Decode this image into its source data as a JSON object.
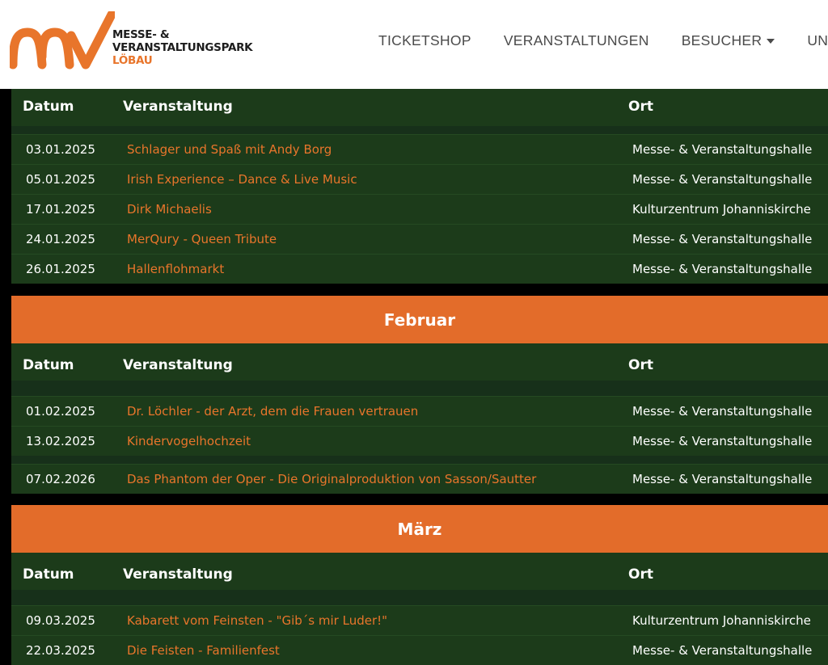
{
  "brand": {
    "line1": "MESSE- &",
    "line2": "VERANSTALTUNGSPARK",
    "line3": "LÖBAU",
    "colors": {
      "orange": "#e8752b",
      "dark_green": "#1c3b1a",
      "month_bar": "#e36c2a"
    }
  },
  "nav": {
    "items": [
      "TICKETSHOP",
      "VERANSTALTUNGEN",
      "BESUCHER",
      "UNTER"
    ]
  },
  "table_headers": {
    "date": "Datum",
    "event": "Veranstaltung",
    "location": "Ort"
  },
  "january": {
    "rows": [
      {
        "date": "03.01.2025",
        "event": "Schlager und Spaß mit Andy Borg",
        "location": "Messe- & Veranstaltungshalle"
      },
      {
        "date": "05.01.2025",
        "event": "Irish Experience – Dance & Live Music",
        "location": "Messe- & Veranstaltungshalle"
      },
      {
        "date": "17.01.2025",
        "event": "Dirk Michaelis",
        "location": "Kulturzentrum Johanniskirche"
      },
      {
        "date": "24.01.2025",
        "event": "MerQury - Queen Tribute",
        "location": "Messe- & Veranstaltungshalle"
      },
      {
        "date": "26.01.2025",
        "event": "Hallenflohmarkt",
        "location": "Messe- & Veranstaltungshalle"
      }
    ]
  },
  "february": {
    "title": "Februar",
    "rows": [
      {
        "date": "01.02.2025",
        "event": "Dr. Löchler - der Arzt, dem die Frauen vertrauen",
        "location": "Messe- & Veranstaltungshalle"
      },
      {
        "date": "13.02.2025",
        "event": "Kindervogelhochzeit",
        "location": "Messe- & Veranstaltungshalle"
      },
      {
        "date": "07.02.2026",
        "event": "Das Phantom der Oper - Die Originalproduktion von Sasson/Sautter",
        "location": "Messe- & Veranstaltungshalle"
      }
    ]
  },
  "march": {
    "title": "März",
    "rows": [
      {
        "date": "09.03.2025",
        "event": "Kabarett vom Feinsten - \"Gib´s mir Luder!\"",
        "location": "Kulturzentrum Johanniskirche"
      },
      {
        "date": "22.03.2025",
        "event": "Die Feisten - Familienfest",
        "location": "Messe- & Veranstaltungshalle"
      }
    ]
  }
}
